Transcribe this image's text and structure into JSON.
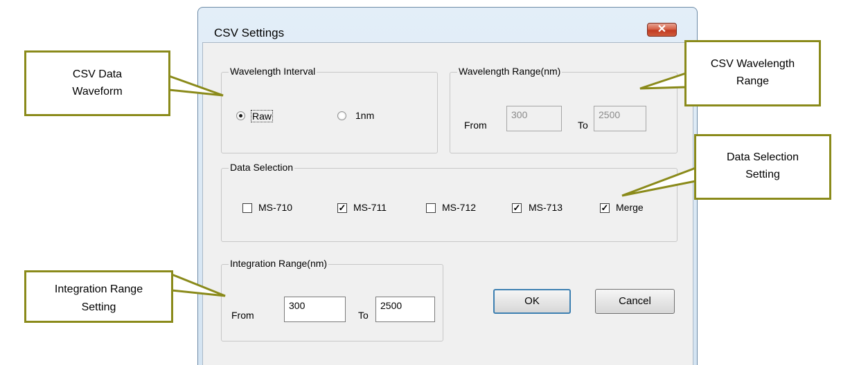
{
  "window": {
    "title": "CSV Settings",
    "close_glyph": "✕"
  },
  "wavelength_interval": {
    "legend": "Wavelength Interval",
    "options": [
      {
        "label": "Raw",
        "selected": true
      },
      {
        "label": "1nm",
        "selected": false
      }
    ]
  },
  "wavelength_range": {
    "legend": "Wavelength Range(nm)",
    "from_label": "From",
    "from_value": "300",
    "to_label": "To",
    "to_value": "2500",
    "enabled": false
  },
  "data_selection": {
    "legend": "Data Selection",
    "items": [
      {
        "label": "MS-710",
        "checked": false
      },
      {
        "label": "MS-711",
        "checked": true
      },
      {
        "label": "MS-712",
        "checked": false
      },
      {
        "label": "MS-713",
        "checked": true
      },
      {
        "label": "Merge",
        "checked": true
      }
    ]
  },
  "integration_range": {
    "legend": "Integration Range(nm)",
    "from_label": "From",
    "from_value": "300",
    "to_label": "To",
    "to_value": "2500"
  },
  "buttons": {
    "ok": "OK",
    "cancel": "Cancel"
  },
  "callouts": {
    "csv_data_waveform": [
      "CSV Data",
      "Waveform"
    ],
    "csv_wavelength_range": [
      "CSV Wavelength",
      "Range"
    ],
    "data_selection_setting": [
      "Data Selection",
      "Setting"
    ],
    "integration_range_setting": [
      "Integration Range",
      "Setting"
    ]
  },
  "colors": {
    "callout_border": "#8a8a1a",
    "close_button": "#c94a2e",
    "default_button_border": "#3c7fb1"
  }
}
